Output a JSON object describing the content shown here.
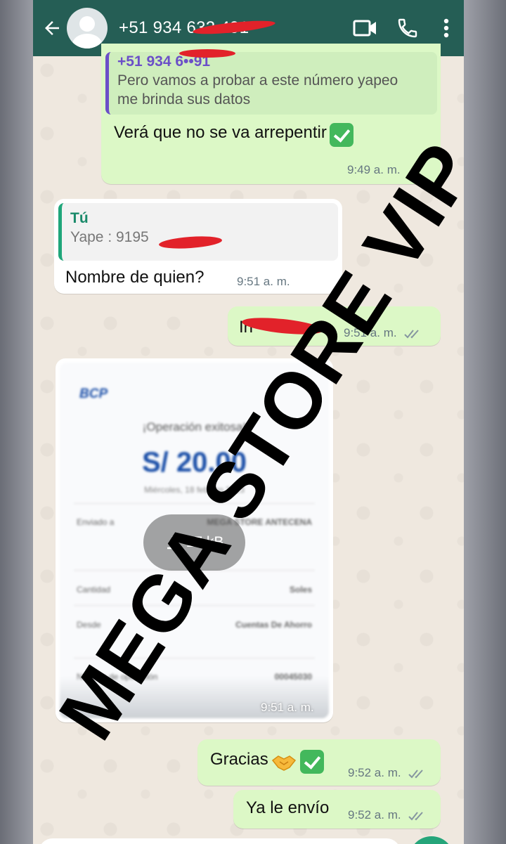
{
  "header": {
    "contact_name": "+51 934 632 491",
    "icons": [
      "back-arrow-icon",
      "avatar",
      "video-call-icon",
      "phone-call-icon",
      "more-vert-icon"
    ]
  },
  "messages": {
    "m1": {
      "quote_sender": "+51 934 6••91",
      "quote_text": "Pero vamos a probar a este número yapeo me brinda sus datos",
      "text": "Verá que no se va arrepentir",
      "time": "9:49 a. m."
    },
    "m2": {
      "quote_sender": "Tú",
      "quote_text": "Yape : 9195",
      "text": "Nombre de quien?",
      "time": "9:51 a. m."
    },
    "m3": {
      "text": "In",
      "time": "9:51 a. m."
    },
    "m4": {
      "receipt_brand": "BCP",
      "receipt_title": "¡Operación exitosa!",
      "receipt_amount": "S/ 20.00",
      "receipt_date": "Miércoles, 18 febrero 2023",
      "receipt_rows": [
        {
          "label": "Enviado a",
          "value": "MEGA STORE ANTECENA"
        },
        {
          "label": "Cantidad",
          "value": "Soles"
        },
        {
          "label": "Desde",
          "value": "Cuentas De Ahorro"
        },
        {
          "label": "Número de operación",
          "value": "00045030"
        }
      ],
      "download_size": "17 kB",
      "time": "9:51 a. m."
    },
    "m5": {
      "text": "Gracias",
      "time": "9:52 a. m."
    },
    "m6": {
      "text": "Ya le envío",
      "time": "9:52 a. m."
    }
  },
  "watermark": "MEGA STORE VIP",
  "colors": {
    "header": "#255e55",
    "outgoing_bubble": "#dcf8c6",
    "incoming_bubble": "#ffffff",
    "quote_bar_other": "#6b4fc8",
    "quote_bar_self": "#1fa67a",
    "tick_gray": "#8696a0",
    "redaction": "#e2222a"
  }
}
